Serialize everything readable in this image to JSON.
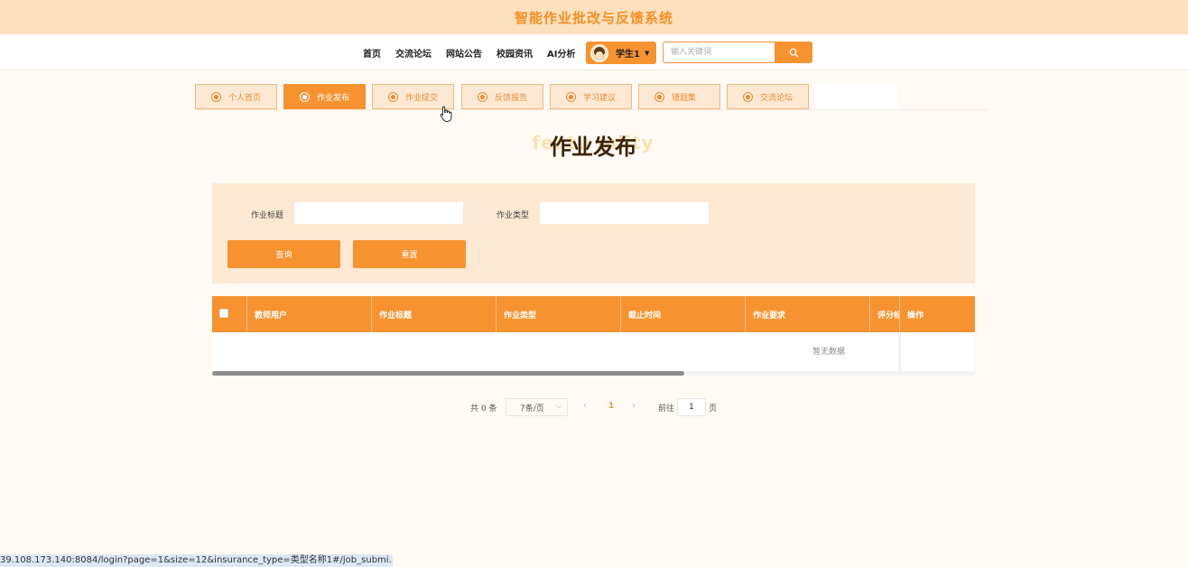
{
  "header": {
    "site_title": "智能作业批改与反馈系统"
  },
  "nav": {
    "links": [
      "首页",
      "交流论坛",
      "网站公告",
      "校园资讯",
      "AI分析"
    ],
    "user": {
      "name": "学生1"
    },
    "search": {
      "placeholder": "输入关键词",
      "icon": "search-icon"
    }
  },
  "tabs": [
    {
      "label": "个人首页",
      "active": false
    },
    {
      "label": "作业发布",
      "active": true
    },
    {
      "label": "作业提交",
      "active": false
    },
    {
      "label": "反馈报告",
      "active": false
    },
    {
      "label": "学习建议",
      "active": false
    },
    {
      "label": "错题集",
      "active": false
    },
    {
      "label": "交流论坛",
      "active": false
    }
  ],
  "page": {
    "heading": "作业发布",
    "heading_bg": "featu            odity"
  },
  "filters": {
    "title_label": "作业标题",
    "title_value": "",
    "type_label": "作业类型",
    "type_value": "",
    "query_button": "查询",
    "reset_button": "重置"
  },
  "table": {
    "columns": [
      "教师用户",
      "作业标题",
      "作业类型",
      "截止时间",
      "作业要求",
      "评分标",
      "操作"
    ],
    "rows": [],
    "empty_text": "暂无数据"
  },
  "pagination": {
    "total_text": "共 0 条",
    "page_size": "7条/页",
    "current_page": "1",
    "goto_label": "前往",
    "goto_value": "1",
    "page_suffix": "页"
  },
  "status_bar": {
    "url": "39.108.173.140:8084/login?page=1&size=12&insurance_type=类型名称1#/job_submi..."
  },
  "colors": {
    "accent": "#f69330",
    "panel": "#fde9d3",
    "top": "#fde0bd",
    "title": "#f29025"
  }
}
